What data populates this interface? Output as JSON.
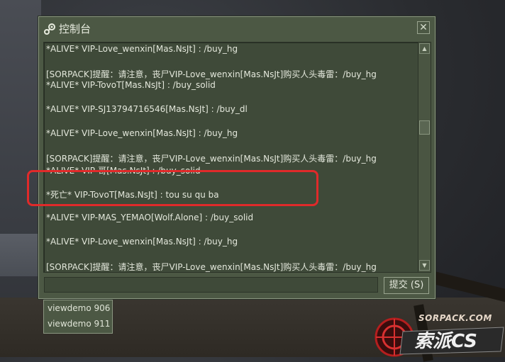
{
  "console": {
    "title": "控制台",
    "close_symbol": "✕",
    "log_lines": [
      "*ALIVE* VIP-Love_wenxin[Mas.NsJt] :   /buy_hg",
      "",
      "[SORPACK]提醒：请注意，丧尸VIP-Love_wenxin[Mas.NsJt]购买人头毒雷：/buy_hg",
      "*ALIVE* VIP-TovoT[Mas.NsJt] :   /buy_solid",
      "",
      "*ALIVE* VIP-SJ13794716546[Mas.NsJt] :   /buy_dl",
      "",
      "*ALIVE* VIP-Love_wenxin[Mas.NsJt] :   /buy_hg",
      "",
      "[SORPACK]提醒：请注意，丧尸VIP-Love_wenxin[Mas.NsJt]购买人头毒雷：/buy_hg",
      "*ALIVE* VIP-哥[Mas.NsJt] :   /buy_solid",
      "",
      "*死亡* VIP-TovoT[Mas.NsJt] :  tou su qu ba",
      "",
      "*ALIVE* VIP-MAS_YEMAO[Wolf.Alone] :   /buy_solid",
      "",
      "*ALIVE* VIP-Love_wenxin[Mas.NsJt] :   /buy_hg",
      "",
      "[SORPACK]提醒：请注意，丧尸VIP-Love_wenxin[Mas.NsJt]购买人头毒雷：/buy_hg"
    ],
    "input_value": "",
    "submit_label": "提交 (S)",
    "scroll_up": "▲",
    "scroll_down": "▼"
  },
  "autocomplete": {
    "items": [
      "viewdemo 906",
      "viewdemo 911"
    ]
  },
  "watermark": {
    "url": "SORPACK.COM",
    "logo_text": "索派CS"
  },
  "colors": {
    "panel": "#4c5844",
    "pane": "#3f4a39",
    "highlight": "#e02a2a",
    "text": "#e3e7db"
  }
}
